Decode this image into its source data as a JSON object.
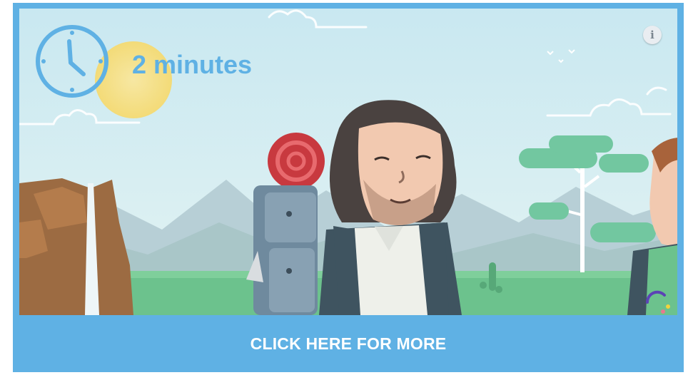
{
  "timer": {
    "icon": "clock-icon",
    "label": "2 minutes"
  },
  "info_button": {
    "icon": "info-icon",
    "glyph": "i"
  },
  "cta": {
    "label": "CLICK HERE FOR MORE"
  },
  "colors": {
    "accent": "#5fb1e4",
    "sky": "#cbeaf2",
    "grass": "#6cc28d"
  }
}
